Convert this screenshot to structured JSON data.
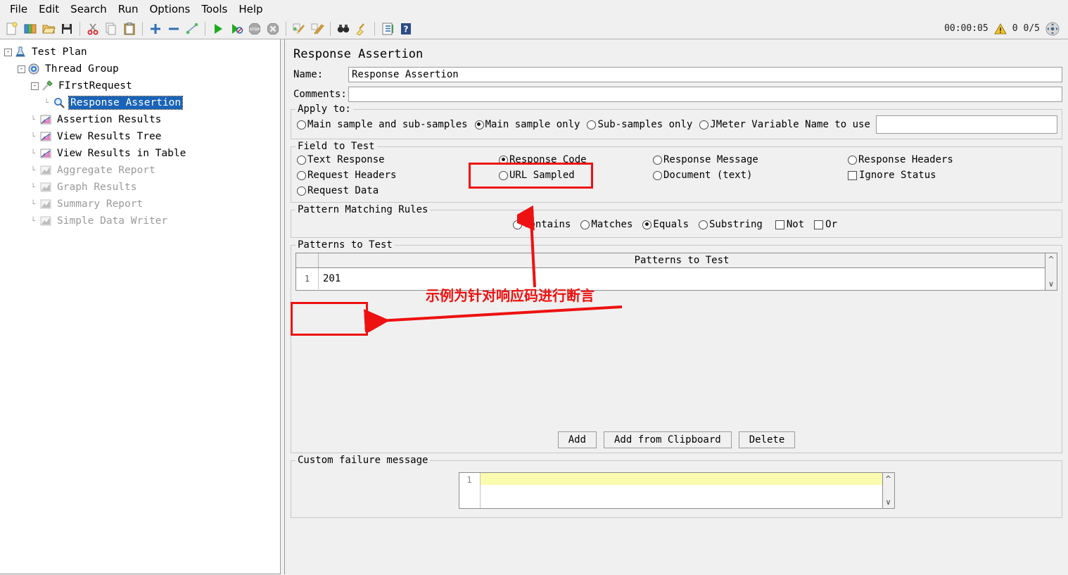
{
  "menubar": {
    "items": [
      "File",
      "Edit",
      "Search",
      "Run",
      "Options",
      "Tools",
      "Help"
    ]
  },
  "toolbar": {
    "icons": [
      {
        "name": "new-icon",
        "glyph": "new"
      },
      {
        "name": "templates-icon",
        "glyph": "templates"
      },
      {
        "name": "open-icon",
        "glyph": "open"
      },
      {
        "name": "save-icon",
        "glyph": "save"
      },
      {
        "name": "cut-icon",
        "glyph": "cut"
      },
      {
        "name": "copy-icon",
        "glyph": "copy"
      },
      {
        "name": "paste-icon",
        "glyph": "paste"
      },
      {
        "name": "expand-all-icon",
        "glyph": "plus"
      },
      {
        "name": "collapse-all-icon",
        "glyph": "minus"
      },
      {
        "name": "toggle-icon",
        "glyph": "toggle"
      },
      {
        "name": "start-icon",
        "glyph": "play"
      },
      {
        "name": "start-no-pauses-icon",
        "glyph": "play-no"
      },
      {
        "name": "stop-icon",
        "glyph": "stop"
      },
      {
        "name": "shutdown-icon",
        "glyph": "shutdown"
      },
      {
        "name": "clear-icon",
        "glyph": "clear"
      },
      {
        "name": "clear-all-icon",
        "glyph": "clear-all"
      },
      {
        "name": "search-icon",
        "glyph": "binoculars"
      },
      {
        "name": "reset-search-icon",
        "glyph": "broom"
      },
      {
        "name": "function-helper-icon",
        "glyph": "list"
      },
      {
        "name": "help-icon",
        "glyph": "help"
      }
    ],
    "timer": "00:00:05",
    "warning_count": "0",
    "thread_count": "0/5"
  },
  "tree": {
    "nodes": [
      {
        "label": "Test Plan",
        "depth": 0,
        "icon": "testplan-icon",
        "toggle": "-",
        "selected": false,
        "dim": false
      },
      {
        "label": "Thread Group",
        "depth": 1,
        "icon": "threadgroup-icon",
        "toggle": "-",
        "selected": false,
        "dim": false
      },
      {
        "label": "FIrstRequest",
        "depth": 2,
        "icon": "httprequest-icon",
        "toggle": "-",
        "selected": false,
        "dim": false
      },
      {
        "label": "Response Assertion",
        "depth": 3,
        "icon": "assertion-icon",
        "toggle": "",
        "selected": true,
        "dim": false
      },
      {
        "label": "Assertion Results",
        "depth": 2,
        "icon": "listener-icon",
        "toggle": "",
        "selected": false,
        "dim": false
      },
      {
        "label": "View Results Tree",
        "depth": 2,
        "icon": "listener-icon",
        "toggle": "",
        "selected": false,
        "dim": false
      },
      {
        "label": "View Results in Table",
        "depth": 2,
        "icon": "listener-icon",
        "toggle": "",
        "selected": false,
        "dim": false
      },
      {
        "label": "Aggregate Report",
        "depth": 2,
        "icon": "listener-disabled-icon",
        "toggle": "",
        "selected": false,
        "dim": true
      },
      {
        "label": "Graph Results",
        "depth": 2,
        "icon": "listener-disabled-icon",
        "toggle": "",
        "selected": false,
        "dim": true
      },
      {
        "label": "Summary Report",
        "depth": 2,
        "icon": "listener-disabled-icon",
        "toggle": "",
        "selected": false,
        "dim": true
      },
      {
        "label": "Simple Data Writer",
        "depth": 2,
        "icon": "listener-disabled-icon",
        "toggle": "",
        "selected": false,
        "dim": true
      }
    ]
  },
  "panel": {
    "title": "Response Assertion",
    "name_label": "Name:",
    "name_value": "Response Assertion",
    "comments_label": "Comments:",
    "comments_value": "",
    "comments_placeholder": "",
    "apply_to": {
      "legend": "Apply to:",
      "options": [
        {
          "label": "Main sample and sub-samples",
          "selected": false
        },
        {
          "label": "Main sample only",
          "selected": true
        },
        {
          "label": "Sub-samples only",
          "selected": false
        },
        {
          "label": "JMeter Variable Name to use",
          "selected": false
        }
      ],
      "variable_value": ""
    },
    "field_to_test": {
      "legend": "Field to Test",
      "options": [
        {
          "label": "Text Response",
          "selected": false,
          "type": "radio"
        },
        {
          "label": "Response Code",
          "selected": true,
          "type": "radio"
        },
        {
          "label": "Response Message",
          "selected": false,
          "type": "radio"
        },
        {
          "label": "Response Headers",
          "selected": false,
          "type": "radio"
        },
        {
          "label": "Request Headers",
          "selected": false,
          "type": "radio"
        },
        {
          "label": "URL Sampled",
          "selected": false,
          "type": "radio"
        },
        {
          "label": "Document (text)",
          "selected": false,
          "type": "radio"
        },
        {
          "label": "Ignore Status",
          "selected": false,
          "type": "checkbox"
        },
        {
          "label": "Request Data",
          "selected": false,
          "type": "radio"
        }
      ]
    },
    "pattern_rules": {
      "legend": "Pattern Matching Rules",
      "options": [
        {
          "label": "Contains",
          "selected": false,
          "type": "radio"
        },
        {
          "label": "Matches",
          "selected": false,
          "type": "radio"
        },
        {
          "label": "Equals",
          "selected": true,
          "type": "radio"
        },
        {
          "label": "Substring",
          "selected": false,
          "type": "radio"
        },
        {
          "label": "Not",
          "selected": false,
          "type": "checkbox"
        },
        {
          "label": "Or",
          "selected": false,
          "type": "checkbox"
        }
      ]
    },
    "patterns": {
      "legend": "Patterns to Test",
      "column_header": "Patterns to Test",
      "rows": [
        {
          "num": "1",
          "value": "201"
        }
      ],
      "buttons": [
        "Add",
        "Add from Clipboard",
        "Delete"
      ]
    },
    "custom_failure": {
      "legend": "Custom failure message",
      "line_number": "1",
      "value": ""
    }
  },
  "annotations": {
    "callout_text": "示例为针对响应码进行断言",
    "color": "#ee1111"
  }
}
